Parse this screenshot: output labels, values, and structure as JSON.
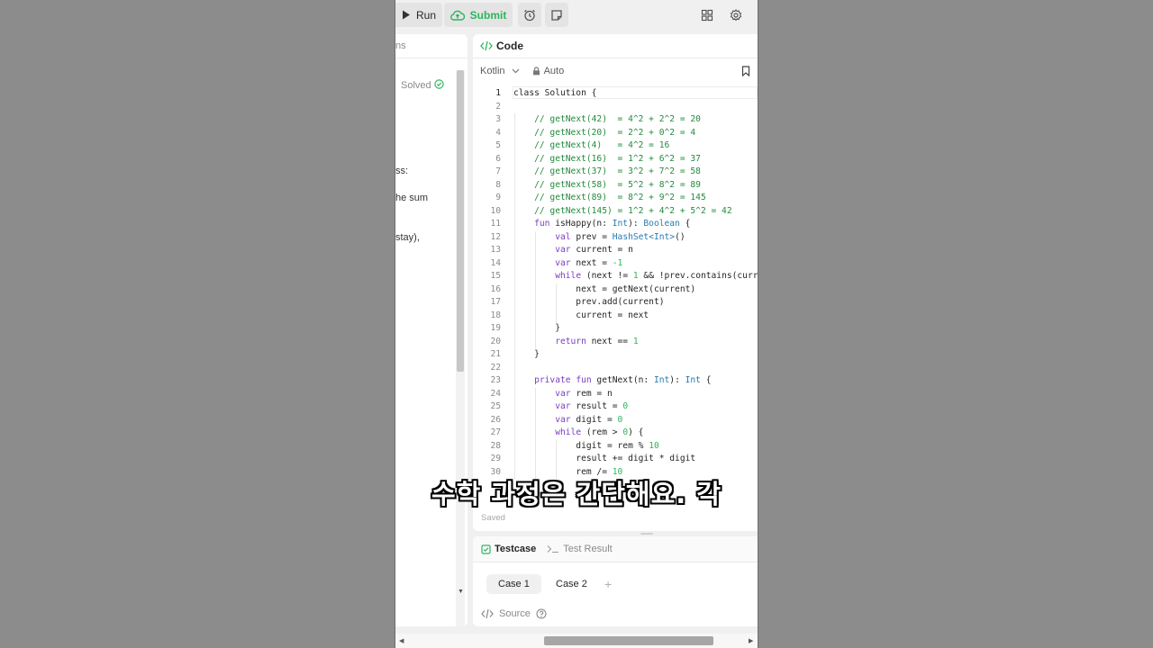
{
  "toolbar": {
    "run_label": "Run",
    "submit_label": "Submit",
    "icons": [
      "play-icon",
      "cloud-upload-icon",
      "alarm-clock-icon",
      "note-icon",
      "layout-icon",
      "gear-icon"
    ]
  },
  "left_panel": {
    "tab_fragment": "ns",
    "solved_label": "Solved",
    "fragments": [
      "ss:",
      "he sum",
      "stay),"
    ]
  },
  "code_panel": {
    "title": "Code",
    "language": "Kotlin",
    "mode": "Auto",
    "saved_label": "Saved",
    "lines": [
      {
        "n": "1",
        "t": [
          [
            "",
            "class Solution {"
          ]
        ]
      },
      {
        "n": "2",
        "t": []
      },
      {
        "n": "3",
        "t": [
          [
            "",
            "    "
          ],
          [
            "cm",
            "// getNext(42)  = 4^2 + 2^2 = 20"
          ]
        ]
      },
      {
        "n": "4",
        "t": [
          [
            "",
            "    "
          ],
          [
            "cm",
            "// getNext(20)  = 2^2 + 0^2 = 4"
          ]
        ]
      },
      {
        "n": "5",
        "t": [
          [
            "",
            "    "
          ],
          [
            "cm",
            "// getNext(4)   = 4^2 = 16"
          ]
        ]
      },
      {
        "n": "6",
        "t": [
          [
            "",
            "    "
          ],
          [
            "cm",
            "// getNext(16)  = 1^2 + 6^2 = 37"
          ]
        ]
      },
      {
        "n": "7",
        "t": [
          [
            "",
            "    "
          ],
          [
            "cm",
            "// getNext(37)  = 3^2 + 7^2 = 58"
          ]
        ]
      },
      {
        "n": "8",
        "t": [
          [
            "",
            "    "
          ],
          [
            "cm",
            "// getNext(58)  = 5^2 + 8^2 = 89"
          ]
        ]
      },
      {
        "n": "9",
        "t": [
          [
            "",
            "    "
          ],
          [
            "cm",
            "// getNext(89)  = 8^2 + 9^2 = 145"
          ]
        ]
      },
      {
        "n": "10",
        "t": [
          [
            "",
            "    "
          ],
          [
            "cm",
            "// getNext(145) = 1^2 + 4^2 + 5^2 = 42"
          ]
        ]
      },
      {
        "n": "11",
        "t": [
          [
            "",
            "    "
          ],
          [
            "kw",
            "fun"
          ],
          [
            "",
            " isHappy(n: "
          ],
          [
            "ty",
            "Int"
          ],
          [
            "",
            "): "
          ],
          [
            "ty",
            "Boolean"
          ],
          [
            "",
            " {"
          ]
        ]
      },
      {
        "n": "12",
        "t": [
          [
            "",
            "        "
          ],
          [
            "kw",
            "val"
          ],
          [
            "",
            " prev = "
          ],
          [
            "ty",
            "HashSet<Int>"
          ],
          [
            "",
            "()"
          ]
        ]
      },
      {
        "n": "13",
        "t": [
          [
            "",
            "        "
          ],
          [
            "kw",
            "var"
          ],
          [
            "",
            " current = n"
          ]
        ]
      },
      {
        "n": "14",
        "t": [
          [
            "",
            "        "
          ],
          [
            "kw",
            "var"
          ],
          [
            "",
            " next = "
          ],
          [
            "num",
            "-1"
          ]
        ]
      },
      {
        "n": "15",
        "t": [
          [
            "",
            "        "
          ],
          [
            "kw",
            "while"
          ],
          [
            "",
            " (next != "
          ],
          [
            "num",
            "1"
          ],
          [
            "",
            " && !prev.contains(current))"
          ]
        ]
      },
      {
        "n": "16",
        "t": [
          [
            "",
            "            next = getNext(current)"
          ]
        ]
      },
      {
        "n": "17",
        "t": [
          [
            "",
            "            prev.add(current)"
          ]
        ]
      },
      {
        "n": "18",
        "t": [
          [
            "",
            "            current = next"
          ]
        ]
      },
      {
        "n": "19",
        "t": [
          [
            "",
            "        }"
          ]
        ]
      },
      {
        "n": "20",
        "t": [
          [
            "",
            "        "
          ],
          [
            "kw",
            "return"
          ],
          [
            "",
            " next == "
          ],
          [
            "num",
            "1"
          ]
        ]
      },
      {
        "n": "21",
        "t": [
          [
            "",
            "    }"
          ]
        ]
      },
      {
        "n": "22",
        "t": []
      },
      {
        "n": "23",
        "t": [
          [
            "",
            "    "
          ],
          [
            "kw",
            "private fun"
          ],
          [
            "",
            " getNext(n: "
          ],
          [
            "ty",
            "Int"
          ],
          [
            "",
            "): "
          ],
          [
            "ty",
            "Int"
          ],
          [
            "",
            " {"
          ]
        ]
      },
      {
        "n": "24",
        "t": [
          [
            "",
            "        "
          ],
          [
            "kw",
            "var"
          ],
          [
            "",
            " rem = n"
          ]
        ]
      },
      {
        "n": "25",
        "t": [
          [
            "",
            "        "
          ],
          [
            "kw",
            "var"
          ],
          [
            "",
            " result = "
          ],
          [
            "num",
            "0"
          ]
        ]
      },
      {
        "n": "26",
        "t": [
          [
            "",
            "        "
          ],
          [
            "kw",
            "var"
          ],
          [
            "",
            " digit = "
          ],
          [
            "num",
            "0"
          ]
        ]
      },
      {
        "n": "27",
        "t": [
          [
            "",
            "        "
          ],
          [
            "kw",
            "while"
          ],
          [
            "",
            " (rem > "
          ],
          [
            "num",
            "0"
          ],
          [
            "",
            ") {"
          ]
        ]
      },
      {
        "n": "28",
        "t": [
          [
            "",
            "            digit = rem % "
          ],
          [
            "num",
            "10"
          ]
        ]
      },
      {
        "n": "29",
        "t": [
          [
            "",
            "            result += digit * digit"
          ]
        ]
      },
      {
        "n": "30",
        "t": [
          [
            "",
            "            rem /= "
          ],
          [
            "num",
            "10"
          ]
        ]
      }
    ]
  },
  "test_panel": {
    "testcase_tab": "Testcase",
    "result_tab": "Test Result",
    "cases": [
      "Case 1",
      "Case 2"
    ],
    "add_label": "+",
    "source_label": "Source"
  },
  "subtitle": "수학 과정은 간단해요. 각",
  "colors": {
    "accent_green": "#2db55d",
    "comment_green": "#238b3d",
    "keyword_purple": "#7a3ec2",
    "type_blue": "#2a7ab0"
  }
}
